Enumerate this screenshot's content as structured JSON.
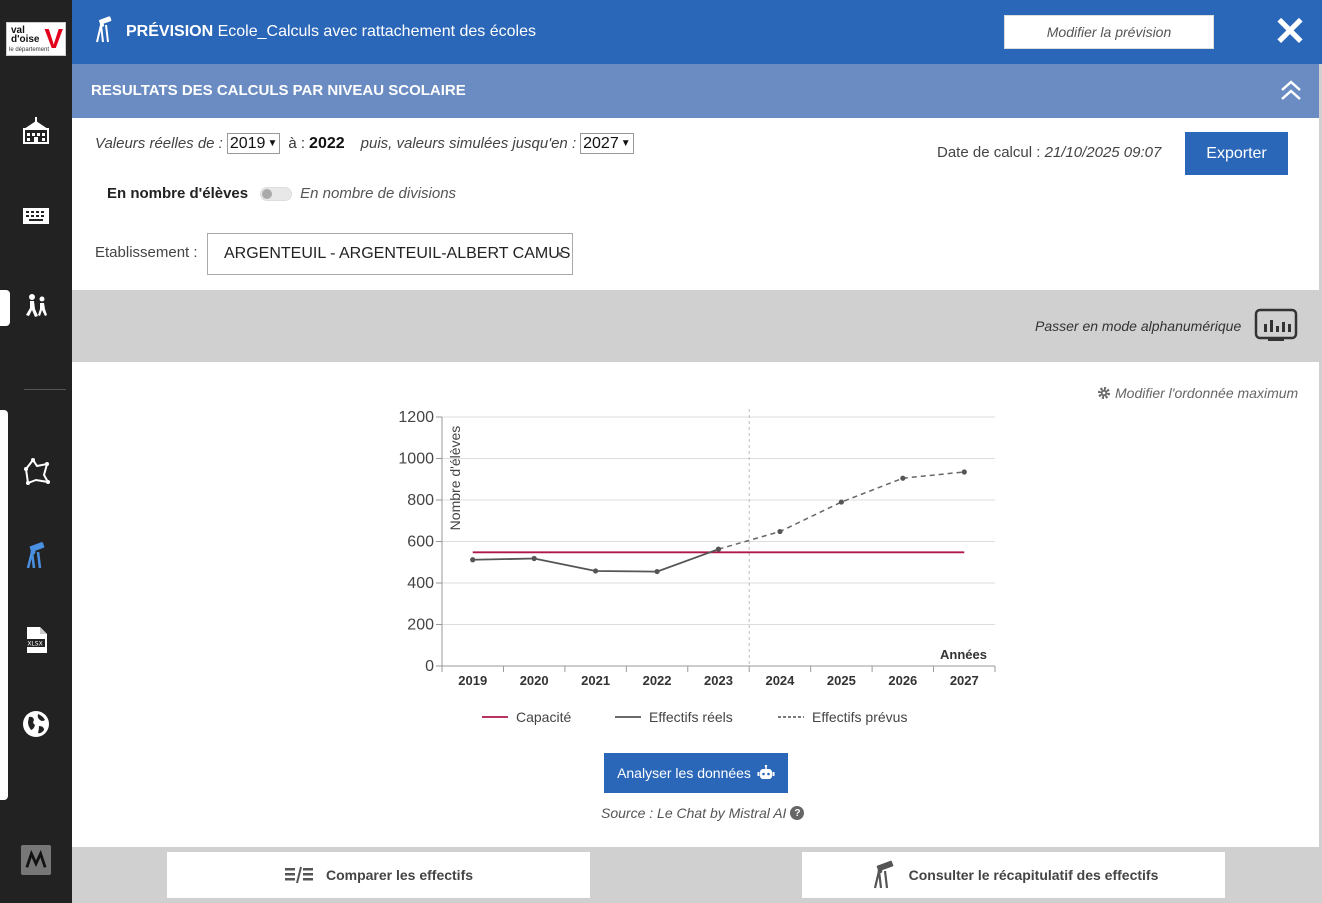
{
  "sidebar": {
    "logo": {
      "line1": "val",
      "line2": "d'oise",
      "line3": "le département",
      "mark": "V"
    },
    "items": [
      {
        "icon": "school-building-icon"
      },
      {
        "icon": "keyboard-icon"
      },
      {
        "icon": "children-walking-icon"
      },
      {
        "icon": "map-area-icon"
      },
      {
        "icon": "telescope-forecast-icon",
        "active": true
      },
      {
        "icon": "xlsx-file-icon"
      },
      {
        "icon": "globe-icon"
      },
      {
        "icon": "m-logo-icon"
      }
    ]
  },
  "header": {
    "prefix": "PRÉVISION",
    "title": "Ecole_Calculs avec rattachement des écoles",
    "modify_button": "Modifier la prévision",
    "close": "✕"
  },
  "section": {
    "title": "RESULTATS DES CALCULS PAR NIVEAU SCOLAIRE"
  },
  "controls": {
    "real_from_label": "Valeurs réelles de :",
    "real_from_value": "2019",
    "to_label": "à :",
    "to_value": "2022",
    "simulated_label": "puis, valeurs simulées jusqu'en :",
    "simulated_value": "2027",
    "calc_date_label": "Date de calcul :",
    "calc_date_value": "21/10/2025 09:07",
    "export_button": "Exporter",
    "toggle_on_label": "En nombre d'élèves",
    "toggle_off_label": "En nombre de divisions",
    "etablissement_label": "Etablissement :",
    "etablissement_value": "ARGENTEUIL - ARGENTEUIL-ALBERT CAMUS"
  },
  "toolbar": {
    "alpha_mode": "Passer en mode alphanumérique",
    "modify_max": "Modifier l'ordonnée maximum"
  },
  "chart_data": {
    "type": "line",
    "ylabel": "Nombre d'élèves",
    "xlabel": "Années",
    "ylim": [
      0,
      1200
    ],
    "yticks": [
      0,
      200,
      400,
      600,
      800,
      1000,
      1200
    ],
    "categories": [
      "2019",
      "2020",
      "2021",
      "2022",
      "2023",
      "2024",
      "2025",
      "2026",
      "2027"
    ],
    "split_year": "2023",
    "series": [
      {
        "name": "Capacité",
        "color": "#b0174b",
        "style": "solid",
        "x": [
          "2019",
          "2020",
          "2021",
          "2022",
          "2023",
          "2024",
          "2025",
          "2026",
          "2027"
        ],
        "values": [
          548,
          548,
          548,
          548,
          548,
          548,
          548,
          548,
          548
        ]
      },
      {
        "name": "Effectifs réels",
        "color": "#555555",
        "style": "solid",
        "x": [
          "2019",
          "2020",
          "2021",
          "2022",
          "2023"
        ],
        "values": [
          512,
          518,
          458,
          455,
          563
        ]
      },
      {
        "name": "Effectifs prévus",
        "color": "#666666",
        "style": "dashed",
        "x": [
          "2023",
          "2024",
          "2025",
          "2026",
          "2027"
        ],
        "values": [
          563,
          648,
          790,
          905,
          935
        ]
      }
    ],
    "grid": true,
    "legend": "bottom"
  },
  "analyse": {
    "button": "Analyser les données",
    "source": "Source : Le Chat by Mistral AI",
    "help": "?"
  },
  "bottom": {
    "compare_button": "Comparer les effectifs",
    "summary_button": "Consulter le récapitulatif des effectifs"
  }
}
